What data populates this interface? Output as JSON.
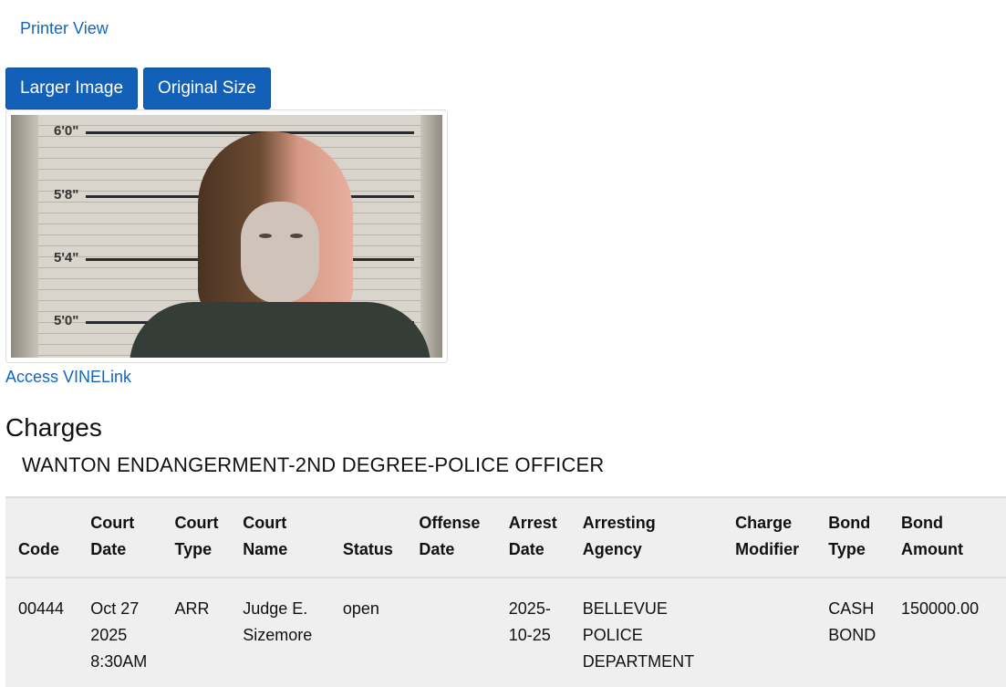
{
  "links": {
    "printer_view": "Printer View",
    "vinelink": "Access VINELink"
  },
  "buttons": {
    "larger_image": "Larger Image",
    "original_size": "Original Size"
  },
  "photo": {
    "height_marks": [
      "6'0\"",
      "5'8\"",
      "5'4\"",
      "5'0\""
    ]
  },
  "charges": {
    "title": "Charges",
    "charge_name": "WANTON ENDANGERMENT-2ND DEGREE-POLICE OFFICER",
    "columns": [
      [
        "Code"
      ],
      [
        "Court",
        "Date"
      ],
      [
        "Court",
        "Type"
      ],
      [
        "Court",
        "Name"
      ],
      [
        "Status"
      ],
      [
        "Offense",
        "Date"
      ],
      [
        "Arrest",
        "Date"
      ],
      [
        "Arresting",
        "Agency"
      ],
      [
        "Charge",
        "Modifier"
      ],
      [
        "Bond",
        "Type"
      ],
      [
        "Bond",
        "Amount"
      ]
    ],
    "rows": [
      [
        [
          "00444"
        ],
        [
          "Oct 27",
          "2025",
          "8:30AM"
        ],
        [
          "ARR"
        ],
        [
          "Judge E.",
          "Sizemore"
        ],
        [
          "open"
        ],
        [],
        [
          "2025-",
          "10-25"
        ],
        [
          "BELLEVUE",
          "POLICE",
          "DEPARTMENT"
        ],
        [],
        [
          "CASH",
          "BOND"
        ],
        [
          "150000.00"
        ]
      ]
    ]
  }
}
